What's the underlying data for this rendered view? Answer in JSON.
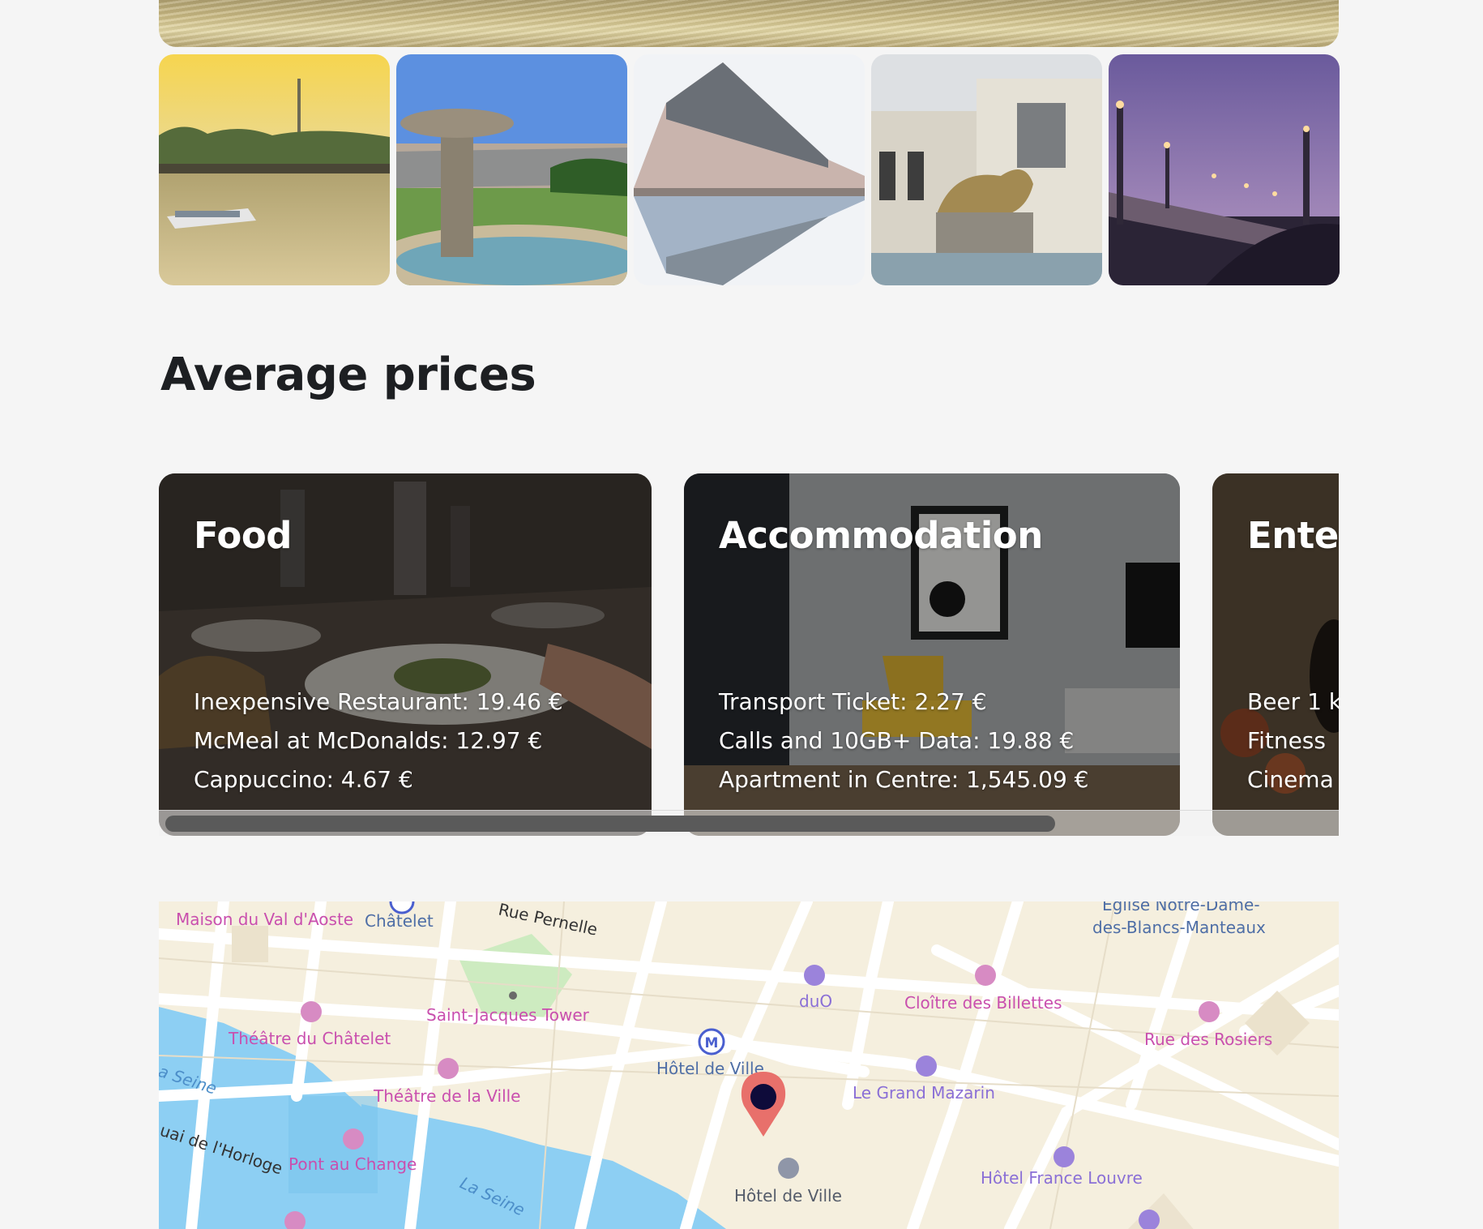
{
  "section": {
    "title": "Average prices"
  },
  "gallery": {
    "hero": "seine-water-photo",
    "thumbnails": [
      "seine-eiffel-photo",
      "place-des-vosges-fountain-photo",
      "rue-de-rivoli-reflection-photo",
      "palais-de-tokyo-bull-photo",
      "pont-alexandre-iii-photo"
    ]
  },
  "cards": [
    {
      "title": "Food",
      "items": [
        "Inexpensive Restaurant: 19.46 €",
        "McMeal at McDonalds: 12.97 €",
        "Cappuccino: 4.67 €"
      ]
    },
    {
      "title": "Accommodation",
      "items": [
        "Transport Ticket: 2.27 €",
        "Calls and 10GB+ Data: 19.88 €",
        "Apartment in Centre: 1,545.09 €"
      ]
    },
    {
      "title": "Enter",
      "items": [
        "Beer 1 k",
        "Fitness",
        "Cinema"
      ]
    }
  ],
  "map": {
    "labels": {
      "maison": "Maison du Val d'Aoste",
      "chatelet": "Châtelet",
      "pernelle": "Rue Pernelle",
      "notre_dame_1": "Église Notre-Dame-",
      "notre_dame_2": "des-Blancs-Manteaux",
      "duo": "duO",
      "billettes": "Cloître des Billettes",
      "rosiers": "Rue des Rosiers",
      "saint_jacques": "Saint-Jacques Tower",
      "theatre_chatelet": "Théâtre du Châtelet",
      "hotel_de_ville_metro": "Hôtel de Ville",
      "grand_mazarin": "Le Grand Mazarin",
      "seine_1": "a Seine",
      "theatre_ville": "Théâtre de la Ville",
      "horloge": "uai de l'Horloge",
      "pont_change": "Pont au Change",
      "seine_2": "La Seine",
      "hotel_de_ville": "Hôtel de Ville",
      "hotel_france_louvre": "Hôtel France Louvre"
    },
    "marker_color": "#e8706b"
  }
}
